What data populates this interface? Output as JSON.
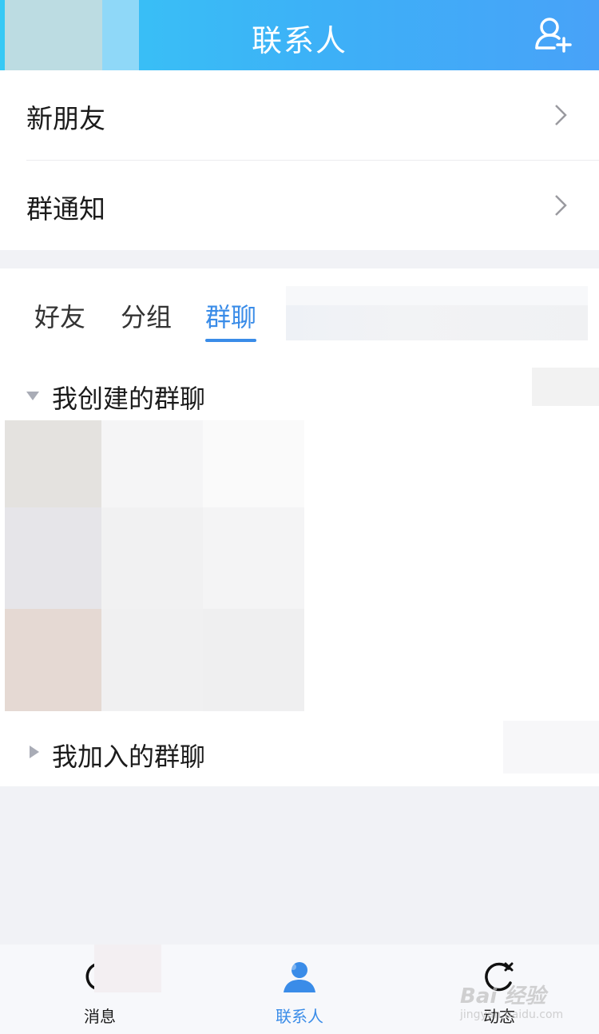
{
  "header": {
    "title": "联系人",
    "add_icon": "add-user-icon",
    "background_start": "#36c9f5",
    "background_end": "#48a2f8"
  },
  "menu": {
    "items": [
      {
        "label": "新朋友",
        "icon": "chevron-right-icon"
      },
      {
        "label": "群通知",
        "icon": "chevron-right-icon"
      }
    ]
  },
  "tabs": {
    "items": [
      {
        "label": "好友",
        "active": false
      },
      {
        "label": "分组",
        "active": false
      },
      {
        "label": "群聊",
        "active": true
      }
    ],
    "accent_color": "#3a8ce8"
  },
  "groups": [
    {
      "label": "我创建的群聊",
      "expanded": true,
      "icon": "triangle-down-icon"
    },
    {
      "label": "我加入的群聊",
      "expanded": false,
      "icon": "triangle-right-icon"
    }
  ],
  "bottom_nav": {
    "items": [
      {
        "label": "消息",
        "icon": "message-icon",
        "active": false
      },
      {
        "label": "联系人",
        "icon": "contacts-icon",
        "active": true
      },
      {
        "label": "动态",
        "icon": "feed-icon",
        "active": false
      }
    ]
  },
  "watermark": {
    "line1": "Bai 经验",
    "line2": "jingyan.baidu.com"
  }
}
